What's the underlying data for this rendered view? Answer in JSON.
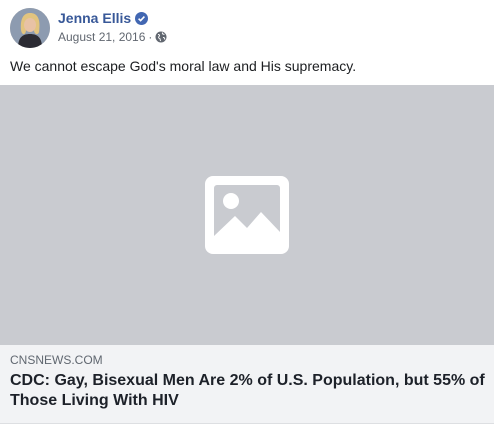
{
  "post": {
    "author": "Jenna Ellis",
    "date": "August 21, 2016",
    "separator": "·",
    "text": "We cannot escape God's moral law and His supremacy.",
    "icons": {
      "verified": "verified-badge-icon",
      "privacy": "globe-icon",
      "media_placeholder": "image-placeholder-icon"
    }
  },
  "link": {
    "domain": "CNSNEWS.COM",
    "headline": "CDC: Gay, Bisexual Men Are 2% of U.S. Population, but 55% of Those Living With HIV"
  },
  "colors": {
    "author_link": "#385898",
    "verified_badge": "#4267b2",
    "media_bg": "#c9cbd0",
    "preview_bg": "#f2f3f5"
  }
}
